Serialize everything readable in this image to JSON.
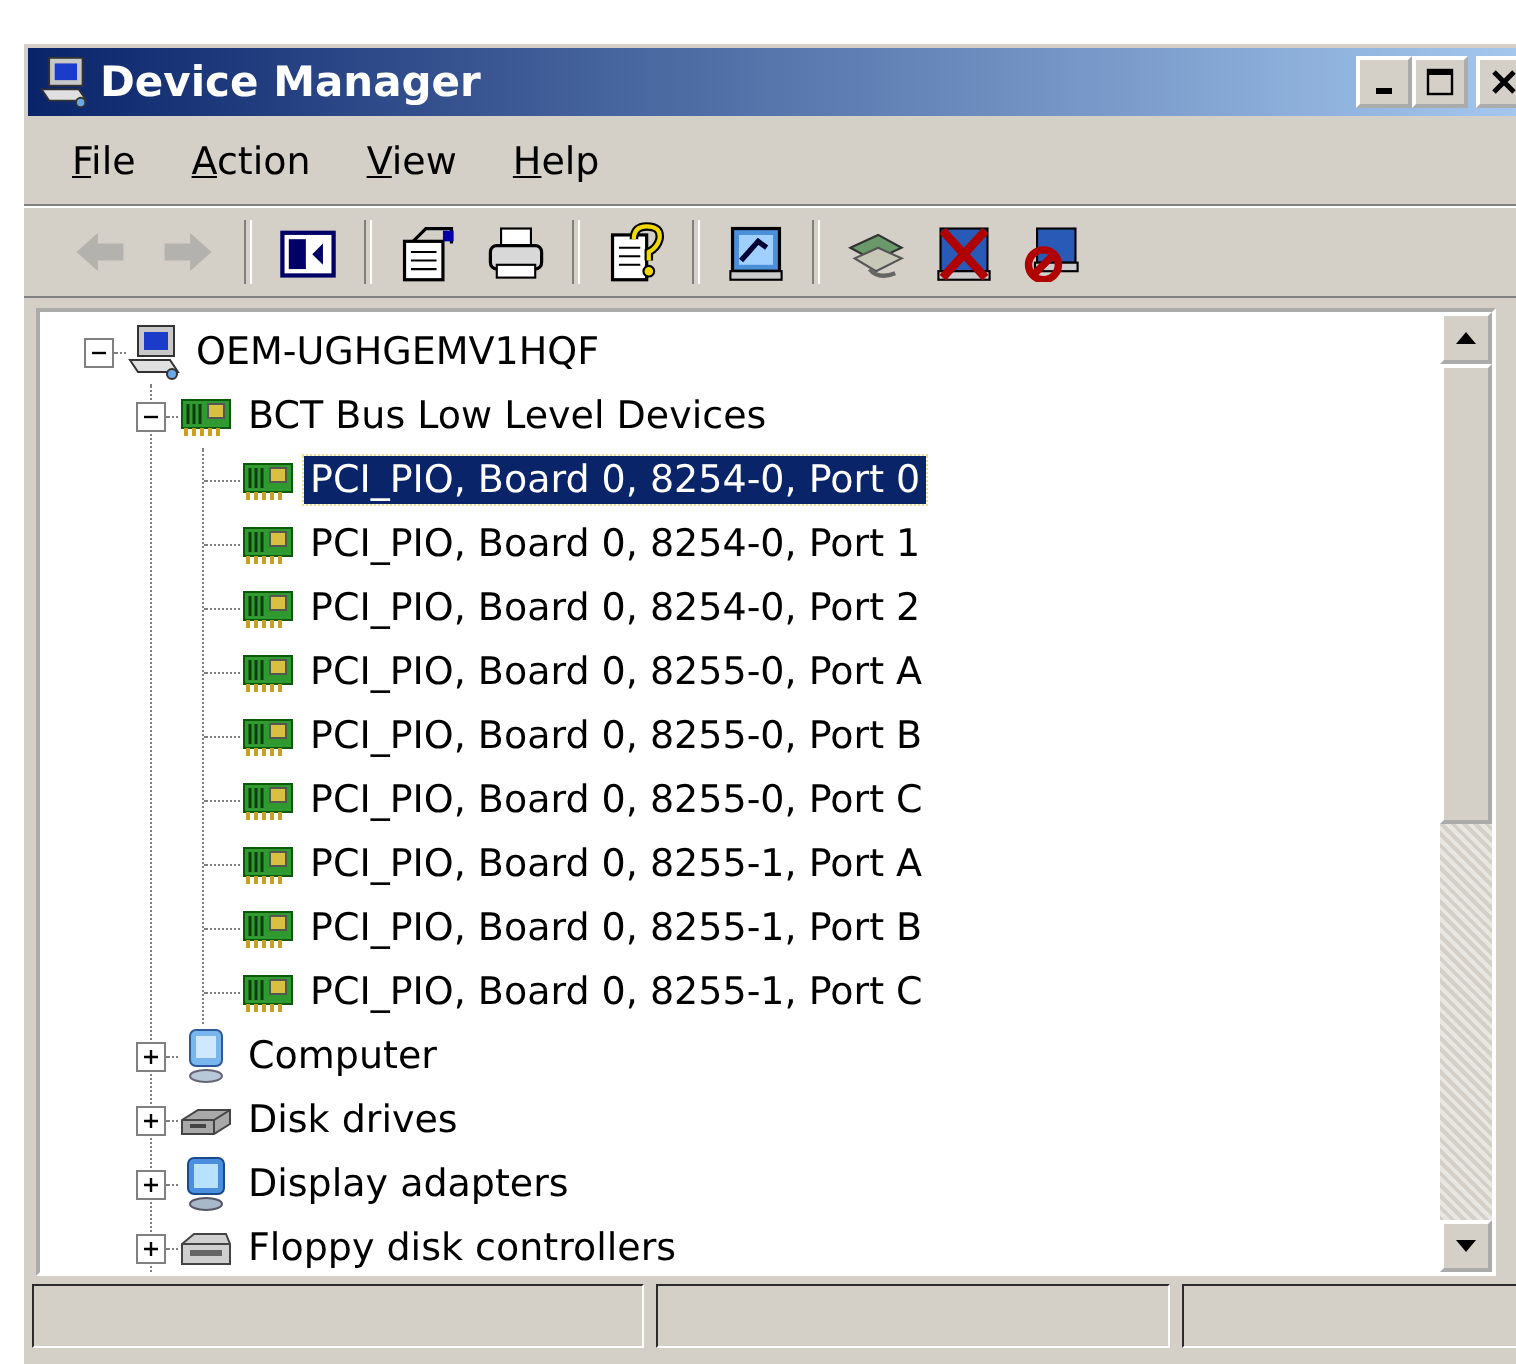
{
  "window": {
    "title": "Device Manager"
  },
  "menu": [
    {
      "label": "File"
    },
    {
      "label": "Action"
    },
    {
      "label": "View"
    },
    {
      "label": "Help"
    }
  ],
  "toolbar": [
    {
      "kind": "back",
      "disabled": true
    },
    {
      "kind": "forward",
      "disabled": true
    },
    {
      "kind": "separator"
    },
    {
      "kind": "tree-toggle",
      "disabled": false
    },
    {
      "kind": "separator"
    },
    {
      "kind": "properties",
      "disabled": false
    },
    {
      "kind": "print",
      "disabled": false
    },
    {
      "kind": "separator"
    },
    {
      "kind": "help",
      "disabled": false
    },
    {
      "kind": "separator"
    },
    {
      "kind": "scan",
      "disabled": false
    },
    {
      "kind": "separator"
    },
    {
      "kind": "update",
      "disabled": false
    },
    {
      "kind": "uninstall",
      "disabled": false
    },
    {
      "kind": "disable",
      "disabled": false
    }
  ],
  "tree": [
    {
      "label": "OEM-UGHGEMV1HQF",
      "kind": "computer",
      "expanded": true,
      "selected": false,
      "children": [
        {
          "label": "BCT Bus Low Level Devices",
          "kind": "board",
          "expanded": true,
          "selected": false,
          "children": [
            {
              "label": "PCI_PIO, Board 0, 8254-0, Port 0",
              "kind": "board",
              "selected": true
            },
            {
              "label": "PCI_PIO, Board 0, 8254-0, Port 1",
              "kind": "board",
              "selected": false
            },
            {
              "label": "PCI_PIO, Board 0, 8254-0, Port 2",
              "kind": "board",
              "selected": false
            },
            {
              "label": "PCI_PIO, Board 0, 8255-0, Port A",
              "kind": "board",
              "selected": false
            },
            {
              "label": "PCI_PIO, Board 0, 8255-0, Port B",
              "kind": "board",
              "selected": false
            },
            {
              "label": "PCI_PIO, Board 0, 8255-0, Port C",
              "kind": "board",
              "selected": false
            },
            {
              "label": "PCI_PIO, Board 0, 8255-1, Port A",
              "kind": "board",
              "selected": false
            },
            {
              "label": "PCI_PIO, Board 0, 8255-1, Port B",
              "kind": "board",
              "selected": false
            },
            {
              "label": "PCI_PIO, Board 0, 8255-1, Port C",
              "kind": "board",
              "selected": false
            }
          ]
        },
        {
          "label": "Computer",
          "kind": "monitor",
          "expanded": false,
          "selected": false
        },
        {
          "label": "Disk drives",
          "kind": "disk",
          "expanded": false,
          "selected": false
        },
        {
          "label": "Display adapters",
          "kind": "display",
          "expanded": false,
          "selected": false
        },
        {
          "label": "Floppy disk controllers",
          "kind": "floppy",
          "expanded": false,
          "selected": false
        }
      ]
    }
  ]
}
